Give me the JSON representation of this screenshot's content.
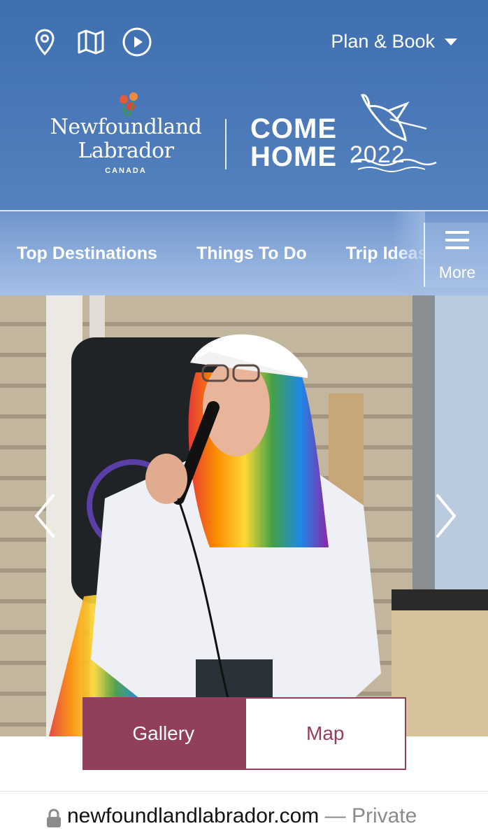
{
  "header": {
    "icons": [
      "location-pin-icon",
      "map-icon",
      "play-icon"
    ],
    "plan_book_label": "Plan & Book",
    "brand": {
      "name_line1": "Newfoundland",
      "name_line2": "Labrador",
      "country": "CANADA",
      "campaign_line1": "COME",
      "campaign_line2": "HOME",
      "campaign_year": "2022"
    }
  },
  "nav": {
    "items": [
      {
        "label": "Top Destinations"
      },
      {
        "label": "Things To Do"
      },
      {
        "label": "Trip Ideas"
      }
    ],
    "more_label": "More"
  },
  "hero": {
    "prev_icon": "chevron-left-icon",
    "next_icon": "chevron-right-icon"
  },
  "tabs": {
    "gallery_label": "Gallery",
    "map_label": "Map"
  },
  "urlbar": {
    "url": "newfoundlandlabrador.com",
    "separator": "—",
    "mode": "Private"
  },
  "colors": {
    "header_blue": "#4a78b8",
    "nav_blue": "#90afdc",
    "accent_maroon": "#913f5a",
    "white": "#ffffff"
  }
}
